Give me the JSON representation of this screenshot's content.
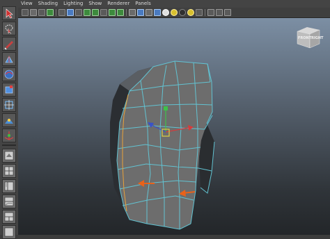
{
  "menu_bar": {
    "items": [
      "View",
      "Shading",
      "Lighting",
      "Show",
      "Renderer",
      "Panels"
    ]
  },
  "viewcube": {
    "front_label": "FRONT",
    "right_label": "RIGHT"
  },
  "colors": {
    "viewport_top": "#7c8fa4",
    "viewport_bottom": "#232629",
    "selection_wire": "#62c3d2",
    "arrow_annotation": "#e8621a",
    "mesh_face": "#6b6b6b"
  }
}
